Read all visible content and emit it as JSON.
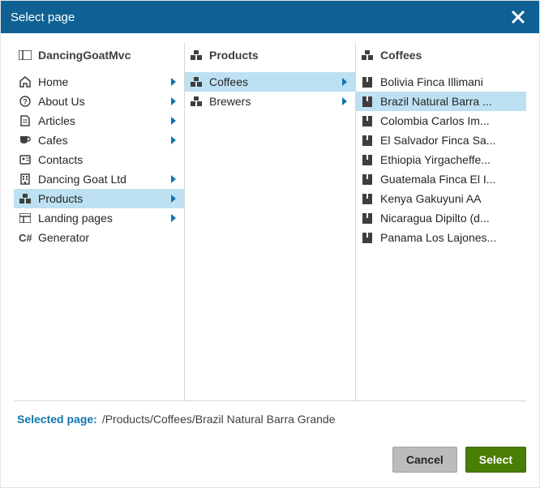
{
  "dialog": {
    "title": "Select page",
    "close_label": "Close"
  },
  "col1": {
    "header": "DancingGoatMvc",
    "items": [
      {
        "icon": "home",
        "label": "Home",
        "children": true,
        "selected": false
      },
      {
        "icon": "question",
        "label": "About Us",
        "children": true,
        "selected": false
      },
      {
        "icon": "doc",
        "label": "Articles",
        "children": true,
        "selected": false
      },
      {
        "icon": "cup",
        "label": "Cafes",
        "children": true,
        "selected": false
      },
      {
        "icon": "contacts",
        "label": "Contacts",
        "children": false,
        "selected": false
      },
      {
        "icon": "building",
        "label": "Dancing Goat Ltd",
        "children": true,
        "selected": false
      },
      {
        "icon": "boxes",
        "label": "Products",
        "children": true,
        "selected": true
      },
      {
        "icon": "layout",
        "label": "Landing pages",
        "children": true,
        "selected": false
      },
      {
        "icon": "csharp",
        "label": "Generator",
        "children": false,
        "selected": false
      }
    ]
  },
  "col2": {
    "header": "Products",
    "items": [
      {
        "icon": "boxes",
        "label": "Coffees",
        "children": true,
        "selected": true
      },
      {
        "icon": "boxes",
        "label": "Brewers",
        "children": true,
        "selected": false
      }
    ]
  },
  "col3": {
    "header": "Coffees",
    "items": [
      {
        "icon": "book",
        "label": "Bolivia Finca Illimani",
        "selected": false
      },
      {
        "icon": "book",
        "label": "Brazil Natural Barra ...",
        "selected": true
      },
      {
        "icon": "book",
        "label": "Colombia Carlos Im...",
        "selected": false
      },
      {
        "icon": "book",
        "label": "El Salvador Finca Sa...",
        "selected": false
      },
      {
        "icon": "book",
        "label": "Ethiopia Yirgacheffe...",
        "selected": false
      },
      {
        "icon": "book",
        "label": "Guatemala Finca El I...",
        "selected": false
      },
      {
        "icon": "book",
        "label": "Kenya Gakuyuni AA",
        "selected": false
      },
      {
        "icon": "book",
        "label": "Nicaragua Dipilto (d...",
        "selected": false
      },
      {
        "icon": "book",
        "label": "Panama Los Lajones...",
        "selected": false
      }
    ]
  },
  "footer": {
    "selected_label": "Selected page:",
    "selected_path": "/Products/Coffees/Brazil Natural Barra Grande",
    "cancel": "Cancel",
    "select": "Select"
  }
}
